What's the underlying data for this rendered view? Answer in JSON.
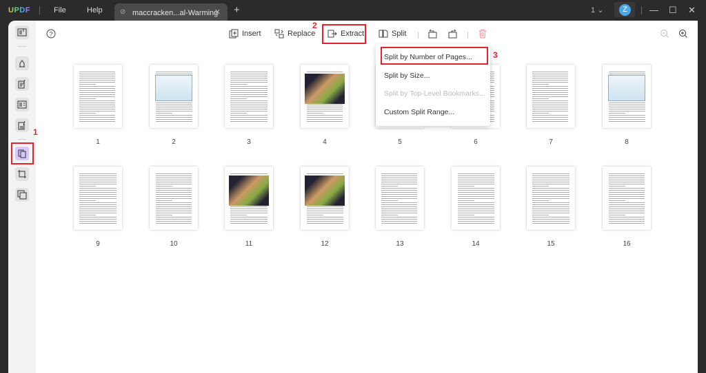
{
  "titlebar": {
    "logo": "UPDF",
    "menu": [
      "File",
      "Help"
    ],
    "tab_title": "maccracken...al-Warming",
    "tab_close": "✕",
    "new_tab": "+",
    "page_indicator": "1",
    "avatar": "Z"
  },
  "toolbar": {
    "insert": "Insert",
    "replace": "Replace",
    "extract": "Extract",
    "split": "Split"
  },
  "split_menu": [
    "Split by Number of Pages...",
    "Split by Size...",
    "Split by Top-Level Bookmarks...",
    "Custom Split Range..."
  ],
  "annotations": [
    "1",
    "2",
    "3"
  ],
  "pages": [
    "1",
    "2",
    "3",
    "4",
    "5",
    "6",
    "7",
    "8",
    "9",
    "10",
    "11",
    "12",
    "13",
    "14",
    "15",
    "16"
  ],
  "colors": {
    "accent": "#e8212a",
    "active_tool": "#d9c8fb"
  }
}
